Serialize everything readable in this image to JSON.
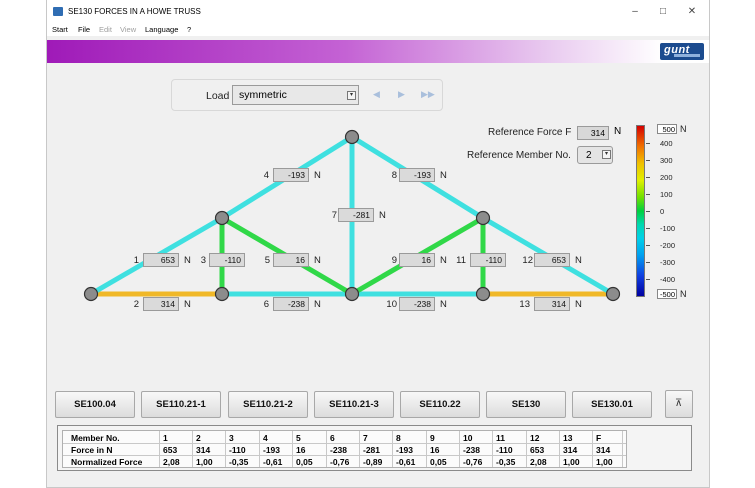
{
  "window": {
    "title": "SE130 FORCES IN A HOWE TRUSS",
    "minimize_icon": "minimize-icon",
    "maximize_icon": "maximize-icon",
    "close_icon": "close-icon"
  },
  "menu": [
    "Start",
    "File",
    "Edit",
    "View",
    "Language",
    "?"
  ],
  "menu_disabled": [
    "Edit",
    "View"
  ],
  "logo": "gunt",
  "load": {
    "label": "Load",
    "value": "symmetric"
  },
  "reference": {
    "force_label": "Reference Force F",
    "force_value": "314",
    "force_unit": "N",
    "member_label": "Reference Member No.",
    "member_value": "2"
  },
  "members": [
    {
      "no": "1",
      "force": "653",
      "unit": "N",
      "color": "#3fe0e0"
    },
    {
      "no": "2",
      "force": "314",
      "unit": "N",
      "color": "#f0b828"
    },
    {
      "no": "3",
      "force": "-110",
      "unit": "N",
      "color": "#30d848"
    },
    {
      "no": "4",
      "force": "-193",
      "unit": "N",
      "color": "#3fe0e0"
    },
    {
      "no": "5",
      "force": "16",
      "unit": "N",
      "color": "#30d848"
    },
    {
      "no": "6",
      "force": "-238",
      "unit": "N",
      "color": "#3fe0e0"
    },
    {
      "no": "7",
      "force": "-281",
      "unit": "N",
      "color": "#3fe0e0"
    },
    {
      "no": "8",
      "force": "-193",
      "unit": "N",
      "color": "#3fe0e0"
    },
    {
      "no": "9",
      "force": "16",
      "unit": "N",
      "color": "#30d848"
    },
    {
      "no": "10",
      "force": "-238",
      "unit": "N",
      "color": "#3fe0e0"
    },
    {
      "no": "11",
      "force": "-110",
      "unit": "N",
      "color": "#30d848"
    },
    {
      "no": "12",
      "force": "653",
      "unit": "N",
      "color": "#3fe0e0"
    },
    {
      "no": "13",
      "force": "314",
      "unit": "N",
      "color": "#f0b828"
    }
  ],
  "scale": {
    "max": "500",
    "min": "-500",
    "unit": "N",
    "ticks": [
      "400",
      "300",
      "200",
      "100",
      "0",
      "-100",
      "-200",
      "-300",
      "-400"
    ]
  },
  "buttons": [
    "SE100.04",
    "SE110.21-1",
    "SE110.21-2",
    "SE110.21-3",
    "SE110.22",
    "SE130",
    "SE130.01"
  ],
  "top_button_icon": "scroll-top-icon",
  "table": {
    "rows": [
      [
        "Member No.",
        "1",
        "2",
        "3",
        "4",
        "5",
        "6",
        "7",
        "8",
        "9",
        "10",
        "11",
        "12",
        "13",
        "F"
      ],
      [
        "Force in N",
        "653",
        "314",
        "-110",
        "-193",
        "16",
        "-238",
        "-281",
        "-193",
        "16",
        "-238",
        "-110",
        "653",
        "314",
        "314"
      ],
      [
        "Normalized Force",
        "2,08",
        "1,00",
        "-0,35",
        "-0,61",
        "0,05",
        "-0,76",
        "-0,89",
        "-0,61",
        "0,05",
        "-0,76",
        "-0,35",
        "2,08",
        "1,00",
        "1,00"
      ]
    ]
  }
}
